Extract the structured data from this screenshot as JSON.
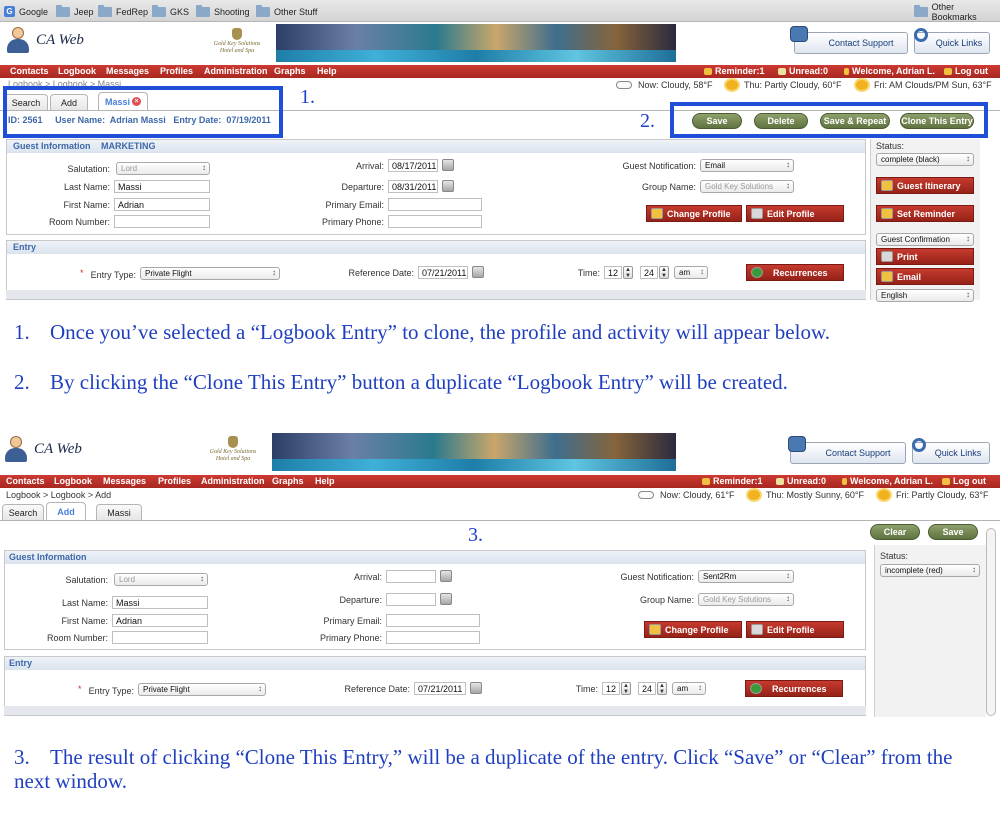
{
  "bookmarks": {
    "items": [
      "Google",
      "Jeep",
      "FedRep",
      "GKS",
      "Shooting",
      "Other Stuff"
    ],
    "other": "Other Bookmarks"
  },
  "app": {
    "name": "CA Web",
    "hotel_logo": "Gold Key Solutions",
    "hotel_logo_sub": "Hotel and Spa",
    "contact_support": "Contact Support",
    "quick_links": "Quick Links"
  },
  "nav": {
    "items": [
      "Contacts",
      "Logbook",
      "Messages",
      "Profiles",
      "Administration",
      "Graphs",
      "Help"
    ],
    "reminder": "Reminder:1",
    "unread": "Unread:0",
    "welcome": "Welcome, Adrian L.",
    "logout": "Log out"
  },
  "screen1": {
    "breadcrumb": "Logbook > Logbook > Massi",
    "tabs": [
      "Search",
      "Add",
      "Massi"
    ],
    "info": {
      "id_label": "ID:",
      "id": "2561",
      "user_label": "User Name:",
      "user": "Adrian Massi",
      "date_label": "Entry Date:",
      "date": "07/19/2011"
    },
    "weather": {
      "now": "Now: Cloudy, 58°F",
      "thu": "Thu: Partly Cloudy, 60°F",
      "fri": "Fri: AM Clouds/PM Sun, 63°F"
    },
    "actions": [
      "Save",
      "Delete",
      "Save & Repeat",
      "Clone This Entry"
    ],
    "guest_section": "Guest Information",
    "marketing": "MARKETING",
    "salutation_label": "Salutation:",
    "salutation": "Lord",
    "lastname_label": "Last Name:",
    "lastname": "Massi",
    "firstname_label": "First Name:",
    "firstname": "Adrian",
    "room_label": "Room Number:",
    "room": "",
    "arrival_label": "Arrival:",
    "arrival": "08/17/2011",
    "departure_label": "Departure:",
    "departure": "08/31/2011",
    "email_label": "Primary Email:",
    "email": "",
    "phone_label": "Primary Phone:",
    "phone": "",
    "notification_label": "Guest Notification:",
    "notification": "Email",
    "group_label": "Group Name:",
    "group": "Gold Key Solutions",
    "change_profile": "Change Profile",
    "edit_profile": "Edit Profile",
    "entry_section": "Entry",
    "entry_type_label": "Entry Type:",
    "entry_type": "Private Flight",
    "ref_date_label": "Reference Date:",
    "ref_date": "07/21/2011",
    "time_label": "Time:",
    "hour": "12",
    "minute": "24",
    "ampm": "am",
    "recurrences": "Recurrences",
    "status_label": "Status:",
    "status": "complete (black)",
    "guest_itinerary": "Guest Itinerary",
    "set_reminder": "Set Reminder",
    "confirmation": "Guest Confirmation",
    "print": "Print",
    "email_btn": "Email",
    "language": "English"
  },
  "annotations": {
    "n1": "1.",
    "n2": "2.",
    "n3": "3.",
    "text1": "Once you’ve selected a “Logbook Entry” to clone, the profile and activity will appear below.",
    "text2": "By clicking the “Clone This Entry” button a duplicate “Logbook Entry” will be created.",
    "text3": "The result of clicking “Clone This Entry,” will be a duplicate of the entry. Click “Save” or “Clear” from the next window."
  },
  "screen2": {
    "breadcrumb": "Logbook > Logbook > Add",
    "tabs": [
      "Search",
      "Add",
      "Massi"
    ],
    "weather": {
      "now": "Now: Cloudy, 61°F",
      "thu": "Thu: Mostly Sunny, 60°F",
      "fri": "Fri: Partly Cloudy, 63°F"
    },
    "actions": [
      "Clear",
      "Save"
    ],
    "guest_section": "Guest Information",
    "salutation_label": "Salutation:",
    "salutation": "Lord",
    "lastname_label": "Last Name:",
    "lastname": "Massi",
    "firstname_label": "First Name:",
    "firstname": "Adrian",
    "room_label": "Room Number:",
    "room": "",
    "arrival_label": "Arrival:",
    "arrival": "",
    "departure_label": "Departure:",
    "departure": "",
    "email_label": "Primary Email:",
    "email": "",
    "phone_label": "Primary Phone:",
    "phone": "",
    "notification_label": "Guest Notification:",
    "notification": "Sent2Rm",
    "group_label": "Group Name:",
    "group": "Gold Key Solutions",
    "change_profile": "Change Profile",
    "edit_profile": "Edit Profile",
    "entry_section": "Entry",
    "entry_type_label": "Entry Type:",
    "entry_type": "Private Flight",
    "ref_date_label": "Reference Date:",
    "ref_date": "07/21/2011",
    "time_label": "Time:",
    "hour": "12",
    "minute": "24",
    "ampm": "am",
    "recurrences": "Recurrences",
    "status_label": "Status:",
    "status": "incomplete (red)"
  },
  "colors": {
    "nav_red": "#b8302a",
    "highlight_blue": "#1f4fd8",
    "button_green": "#6f8450",
    "instruction_blue": "#1f3fbf"
  }
}
